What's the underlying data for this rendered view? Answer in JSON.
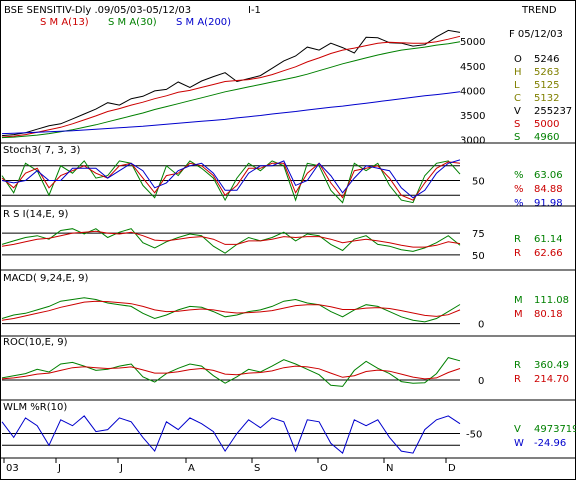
{
  "header": {
    "title": "BSE SENSITIV-Dly .09/05/03-05/12/03",
    "interval": "I-1",
    "trend_label": "TREND",
    "sma13": "S M A(13)",
    "sma30": "S M A(30)",
    "sma200": "S M A(200)"
  },
  "colors": {
    "price": "#000000",
    "sma13": "#cc0000",
    "sma30": "#008000",
    "sma200": "#0000cc",
    "olive": "#808000"
  },
  "price_panel": {
    "date_label": "F 05/12/03",
    "rows": [
      {
        "key": "O",
        "value": "5246",
        "color": "#000000"
      },
      {
        "key": "H",
        "value": "5263",
        "color": "#808000"
      },
      {
        "key": "L",
        "value": "5125",
        "color": "#808000"
      },
      {
        "key": "C",
        "value": "5132",
        "color": "#808000"
      },
      {
        "key": "V",
        "value": "255237",
        "color": "#000000"
      },
      {
        "key": "S",
        "value": "5000",
        "color": "#cc0000"
      },
      {
        "key": "S",
        "value": "4960",
        "color": "#008000"
      }
    ]
  },
  "stoch_panel": {
    "title": "Stoch3( 7, 3, 3)",
    "rows": [
      {
        "key": "%",
        "value": "63.06",
        "color": "#008000"
      },
      {
        "key": "%",
        "value": "84.88",
        "color": "#cc0000"
      },
      {
        "key": "%",
        "value": "91.98",
        "color": "#0000cc"
      }
    ]
  },
  "rsi_panel": {
    "title": "R S I(14,E, 9)",
    "rows": [
      {
        "key": "R",
        "value": "61.14",
        "color": "#008000"
      },
      {
        "key": "R",
        "value": "62.66",
        "color": "#cc0000"
      }
    ]
  },
  "macd_panel": {
    "title": "MACD( 9,24,E, 9)",
    "rows": [
      {
        "key": "M",
        "value": "111.08",
        "color": "#008000"
      },
      {
        "key": "M",
        "value": "80.18",
        "color": "#cc0000"
      }
    ]
  },
  "roc_panel": {
    "title": "ROC(10,E, 9)",
    "rows": [
      {
        "key": "R",
        "value": "360.49",
        "color": "#008000"
      },
      {
        "key": "R",
        "value": "214.70",
        "color": "#cc0000"
      }
    ]
  },
  "wlm_panel": {
    "title": "WLM %R(10)",
    "rows": [
      {
        "key": "V",
        "value": "4973719",
        "color": "#008000"
      },
      {
        "key": "W",
        "value": "-24.96",
        "color": "#0000cc"
      }
    ]
  },
  "chart_data": [
    {
      "type": "line",
      "title": "BSE SENSITIV-Dly .09/05/03-05/12/03",
      "x_labels": [
        "03",
        "J",
        "J",
        "A",
        "S",
        "O",
        "N",
        "D"
      ],
      "y_ticks": [
        3000,
        3500,
        4000,
        4500,
        5000
      ],
      "ylim": [
        2950,
        5350
      ],
      "series": [
        {
          "name": "Price",
          "color": "#000000",
          "values": [
            3080,
            3100,
            3140,
            3210,
            3280,
            3320,
            3420,
            3520,
            3620,
            3750,
            3700,
            3830,
            3880,
            3990,
            4020,
            4170,
            4060,
            4190,
            4280,
            4360,
            4180,
            4240,
            4300,
            4450,
            4600,
            4700,
            4880,
            4820,
            4960,
            4870,
            4760,
            5080,
            5070,
            4970,
            4960,
            4900,
            4930,
            5090,
            5220,
            5180
          ]
        },
        {
          "name": "S M A(13)",
          "color": "#cc0000",
          "values": [
            3050,
            3070,
            3100,
            3150,
            3200,
            3250,
            3320,
            3400,
            3480,
            3570,
            3630,
            3700,
            3760,
            3830,
            3890,
            3960,
            4000,
            4060,
            4120,
            4180,
            4200,
            4220,
            4260,
            4320,
            4400,
            4480,
            4580,
            4660,
            4750,
            4820,
            4860,
            4910,
            4960,
            4980,
            4970,
            4960,
            4960,
            4990,
            5040,
            5100
          ]
        },
        {
          "name": "S M A(30)",
          "color": "#008000",
          "values": [
            3040,
            3050,
            3070,
            3090,
            3120,
            3160,
            3200,
            3250,
            3300,
            3360,
            3420,
            3480,
            3540,
            3610,
            3670,
            3730,
            3790,
            3850,
            3910,
            3970,
            4020,
            4070,
            4120,
            4170,
            4220,
            4270,
            4330,
            4400,
            4470,
            4540,
            4600,
            4660,
            4720,
            4770,
            4820,
            4850,
            4880,
            4920,
            4950,
            4990
          ]
        },
        {
          "name": "S M A(200)",
          "color": "#0000cc",
          "values": [
            3120,
            3130,
            3140,
            3150,
            3160,
            3170,
            3180,
            3195,
            3210,
            3225,
            3240,
            3255,
            3270,
            3290,
            3310,
            3330,
            3350,
            3370,
            3390,
            3410,
            3440,
            3465,
            3490,
            3520,
            3545,
            3570,
            3600,
            3630,
            3655,
            3680,
            3710,
            3740,
            3770,
            3800,
            3830,
            3860,
            3890,
            3915,
            3940,
            3970
          ]
        }
      ]
    },
    {
      "type": "line",
      "title": "Stoch3( 7, 3, 3)",
      "y_ticks": [
        50
      ],
      "ylim": [
        0,
        100
      ],
      "series": [
        {
          "name": "%",
          "color": "#008000",
          "values": [
            60,
            25,
            85,
            70,
            20,
            80,
            65,
            90,
            55,
            60,
            90,
            85,
            40,
            15,
            80,
            60,
            90,
            75,
            55,
            10,
            55,
            85,
            70,
            90,
            80,
            10,
            85,
            80,
            30,
            5,
            85,
            70,
            85,
            40,
            10,
            5,
            60,
            85,
            90,
            63
          ]
        },
        {
          "name": "%",
          "color": "#cc0000",
          "values": [
            55,
            35,
            65,
            75,
            35,
            60,
            70,
            80,
            65,
            55,
            80,
            85,
            55,
            25,
            60,
            65,
            85,
            80,
            60,
            20,
            40,
            75,
            75,
            85,
            85,
            25,
            65,
            85,
            45,
            15,
            70,
            75,
            80,
            55,
            20,
            10,
            45,
            75,
            88,
            85
          ]
        },
        {
          "name": "%",
          "color": "#0000cc",
          "values": [
            50,
            45,
            50,
            70,
            50,
            50,
            75,
            75,
            75,
            55,
            70,
            85,
            70,
            35,
            45,
            70,
            80,
            85,
            65,
            30,
            30,
            65,
            80,
            80,
            90,
            40,
            50,
            85,
            60,
            25,
            55,
            80,
            75,
            70,
            35,
            15,
            30,
            65,
            85,
            92
          ]
        }
      ]
    },
    {
      "type": "line",
      "title": "R S I(14,E, 9)",
      "y_ticks": [
        50,
        75
      ],
      "ylim": [
        35,
        90
      ],
      "series": [
        {
          "name": "R",
          "color": "#008000",
          "values": [
            62,
            66,
            70,
            72,
            68,
            78,
            80,
            74,
            80,
            70,
            76,
            80,
            64,
            58,
            65,
            70,
            74,
            72,
            60,
            52,
            62,
            70,
            66,
            70,
            76,
            66,
            74,
            72,
            62,
            55,
            68,
            72,
            62,
            60,
            56,
            54,
            58,
            64,
            72,
            61
          ]
        },
        {
          "name": "R",
          "color": "#cc0000",
          "values": [
            60,
            62,
            65,
            68,
            69,
            72,
            75,
            76,
            77,
            75,
            74,
            76,
            72,
            67,
            66,
            68,
            70,
            71,
            68,
            62,
            62,
            66,
            66,
            68,
            71,
            70,
            71,
            71,
            68,
            64,
            66,
            68,
            66,
            64,
            61,
            59,
            59,
            61,
            65,
            63
          ]
        }
      ]
    },
    {
      "type": "line",
      "title": "MACD( 9,24,E, 9)",
      "y_ticks": [
        0
      ],
      "ylim": [
        -60,
        230
      ],
      "series": [
        {
          "name": "M",
          "color": "#008000",
          "values": [
            30,
            50,
            60,
            80,
            100,
            130,
            140,
            150,
            140,
            120,
            110,
            100,
            60,
            30,
            50,
            80,
            100,
            95,
            70,
            40,
            50,
            70,
            80,
            100,
            130,
            140,
            120,
            110,
            70,
            40,
            80,
            110,
            100,
            70,
            40,
            20,
            10,
            30,
            70,
            111
          ]
        },
        {
          "name": "M",
          "color": "#cc0000",
          "values": [
            20,
            30,
            45,
            60,
            75,
            95,
            110,
            125,
            130,
            128,
            122,
            116,
            100,
            80,
            70,
            72,
            80,
            85,
            80,
            68,
            62,
            64,
            68,
            76,
            90,
            105,
            110,
            110,
            98,
            82,
            82,
            90,
            93,
            88,
            76,
            62,
            48,
            42,
            52,
            80
          ]
        }
      ]
    },
    {
      "type": "line",
      "title": "ROC(10,E, 9)",
      "y_ticks": [
        0
      ],
      "ylim": [
        -300,
        600
      ],
      "series": [
        {
          "name": "R",
          "color": "#008000",
          "values": [
            40,
            80,
            120,
            200,
            150,
            300,
            330,
            260,
            180,
            200,
            260,
            300,
            60,
            -40,
            120,
            220,
            300,
            260,
            80,
            -60,
            60,
            200,
            150,
            260,
            380,
            300,
            200,
            100,
            -100,
            -120,
            180,
            350,
            220,
            120,
            -30,
            -60,
            -50,
            120,
            420,
            360
          ]
        },
        {
          "name": "R",
          "color": "#cc0000",
          "values": [
            20,
            40,
            70,
            110,
            130,
            180,
            230,
            250,
            230,
            215,
            225,
            245,
            190,
            130,
            130,
            155,
            195,
            215,
            180,
            110,
            100,
            130,
            140,
            170,
            230,
            260,
            245,
            210,
            130,
            50,
            80,
            160,
            185,
            165,
            110,
            55,
            20,
            40,
            140,
            215
          ]
        }
      ]
    },
    {
      "type": "line",
      "title": "WLM %R(10)",
      "y_ticks": [
        -50
      ],
      "ylim": [
        -110,
        5
      ],
      "series": [
        {
          "name": "W",
          "color": "#0000cc",
          "values": [
            -20,
            -60,
            -10,
            -30,
            -80,
            -15,
            -30,
            -5,
            -45,
            -40,
            -10,
            -20,
            -60,
            -95,
            -20,
            -40,
            -10,
            -25,
            -45,
            -95,
            -50,
            -15,
            -35,
            -10,
            -20,
            -95,
            -15,
            -20,
            -75,
            -100,
            -15,
            -30,
            -15,
            -60,
            -95,
            -100,
            -40,
            -15,
            -5,
            -25
          ]
        }
      ]
    }
  ]
}
